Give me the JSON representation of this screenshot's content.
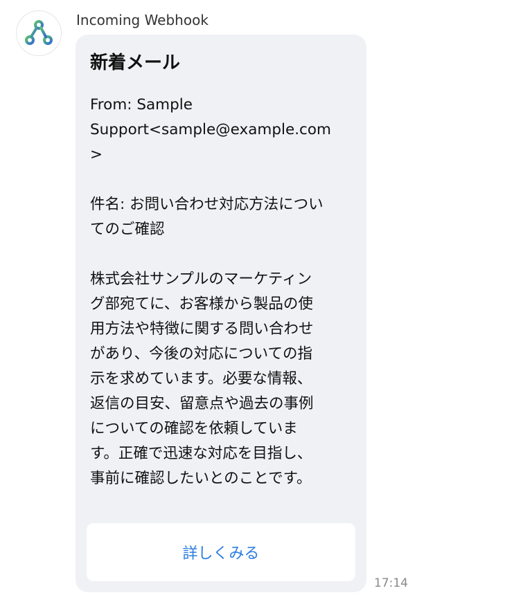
{
  "message": {
    "sender": "Incoming Webhook",
    "avatar_icon": "webhook-icon",
    "timestamp": "17:14",
    "card": {
      "title": "新着メール",
      "body": "From: Sample\nSupport<sample@example.com\n>\n\n件名: お問い合わせ対応方法につい\nてのご確認\n\n株式会社サンプルのマーケティン\nグ部宛てに、お客様から製品の使\n用方法や特徴に関する問い合わせ\nがあり、今後の対応についての指\n示を求めています。必要な情報、\n返信の目安、留意点や過去の事例\nについての確認を依頼していま\nす。正確で迅速な対応を目指し、\n事前に確認したいとのことです。",
      "button_label": "詳しくみる"
    }
  },
  "colors": {
    "bubble_bg": "#f0f1f5",
    "button_text": "#2a7de1",
    "webhook_green": "#5fc36a",
    "webhook_blue": "#2f6bd8"
  }
}
